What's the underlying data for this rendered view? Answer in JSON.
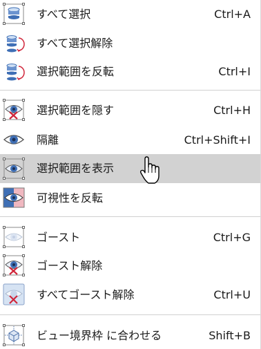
{
  "menu": {
    "items": [
      {
        "label": "すべて選択",
        "shortcut": "Ctrl+A",
        "icon": "select-all-icon"
      },
      {
        "label": "すべて選択解除",
        "shortcut": "",
        "icon": "deselect-all-icon"
      },
      {
        "label": "選択範囲を反転",
        "shortcut": "Ctrl+I",
        "icon": "invert-selection-icon"
      },
      {
        "label": "選択範囲を隠す",
        "shortcut": "Ctrl+H",
        "icon": "hide-selection-icon"
      },
      {
        "label": "隔離",
        "shortcut": "Ctrl+Shift+I",
        "icon": "isolate-eye-icon"
      },
      {
        "label": "選択範囲を表示",
        "shortcut": "",
        "icon": "show-selection-icon"
      },
      {
        "label": "可視性を反転",
        "shortcut": "",
        "icon": "invert-visibility-icon"
      },
      {
        "label": "ゴースト",
        "shortcut": "Ctrl+G",
        "icon": "ghost-icon"
      },
      {
        "label": "ゴースト解除",
        "shortcut": "",
        "icon": "unghost-icon"
      },
      {
        "label": "すべてゴースト解除",
        "shortcut": "Ctrl+U",
        "icon": "unghost-all-icon"
      },
      {
        "label": "ビュー境界枠 に合わせる",
        "shortcut": "Shift+B",
        "icon": "fit-bounding-box-icon"
      }
    ],
    "hovered_index": 5
  },
  "colors": {
    "hover_background": "#d2d2d2",
    "separator": "#d0d0d0",
    "icon_blue": "#3f6fb5",
    "icon_red": "#d0253a"
  }
}
